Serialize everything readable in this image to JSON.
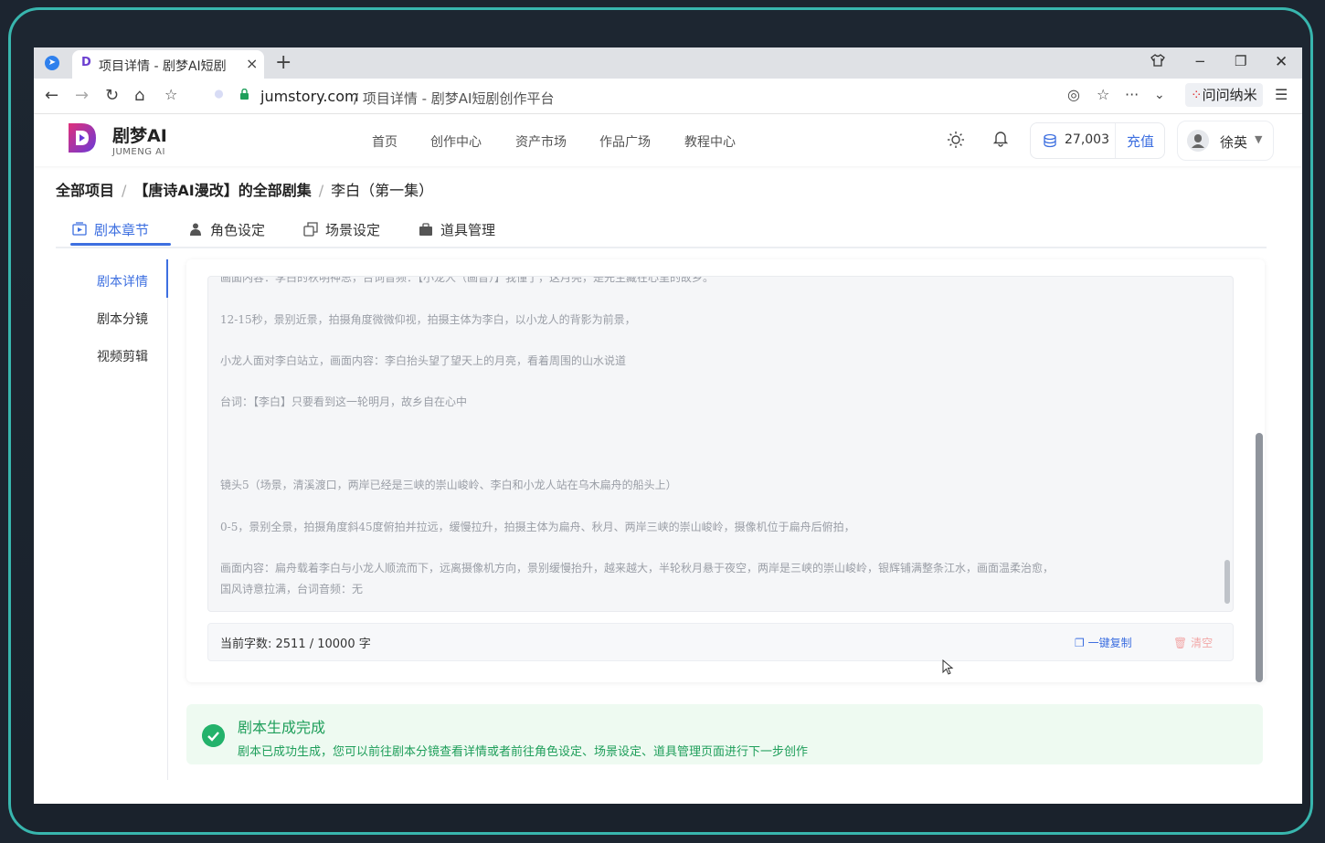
{
  "browser": {
    "tab_title": "项目详情 - 剧梦AI短剧",
    "tab_close": "×",
    "new_tab": "+",
    "url_domain": "jumstory.com",
    "url_rest": " / 项目详情 - 剧梦AI短剧创作平台",
    "extension_label": "问问纳米"
  },
  "app": {
    "logo_title": "剧梦AI",
    "logo_sub": "JUMENG AI",
    "nav": [
      "首页",
      "创作中心",
      "资产市场",
      "作品广场",
      "教程中心"
    ],
    "credits": "27,003",
    "recharge": "充值",
    "user_name": "徐英",
    "user_caret": "▼"
  },
  "breadcrumb": {
    "root": "全部项目",
    "project": "【唐诗AI漫改】的全部剧集",
    "current": "李白（第一集）",
    "separator": "/"
  },
  "tabs": [
    "剧本章节",
    "角色设定",
    "场景设定",
    "道具管理"
  ],
  "side_menu": [
    "剧本详情",
    "剧本分镜",
    "视频剪辑"
  ],
  "script_lines": [
    "画面内容：李白的秋明神思，台词音频：【小龙人（画音）】我懂了，这月亮，是先生藏在心里的故乡。",
    "12-15秒，景别近景，拍摄角度微微仰视，拍摄主体为李白，以小龙人的背影为前景，",
    "小龙人面对李白站立，画面内容：李白抬头望了望天上的月亮，看着周围的山水说道",
    "台词：【李白】只要看到这一轮明月，故乡自在心中",
    "镜头5（场景，清溪渡口，两岸已经是三峡的崇山峻岭、李白和小龙人站在乌木扁舟的船头上）",
    "0-5，景别全景，拍摄角度斜45度俯拍并拉远，缓慢拉升，拍摄主体为扁舟、秋月、两岸三峡的崇山峻岭，摄像机位于扁舟后俯拍，",
    "画面内容：扁舟载着李白与小龙人顺流而下，远离摄像机方向，景别缓慢抬升，越来越大，半轮秋月悬于夜空，两岸是三峡的崇山峻岭，银辉铺满整条江水，画面温柔治愈，",
    "国风诗意拉满，台词音频：无"
  ],
  "stats": {
    "word_count": "当前字数: 2511 / 10000 字",
    "copy_label": "一键复制",
    "clear_label": "清空"
  },
  "success": {
    "title": "剧本生成完成",
    "description": "剧本已成功生成，您可以前往剧本分镜查看详情或者前往角色设定、场景设定、道具管理页面进行下一步创作"
  },
  "colors": {
    "accent": "#3d6fe0",
    "success": "#1e9e5a",
    "frame": "#38b6ae"
  }
}
